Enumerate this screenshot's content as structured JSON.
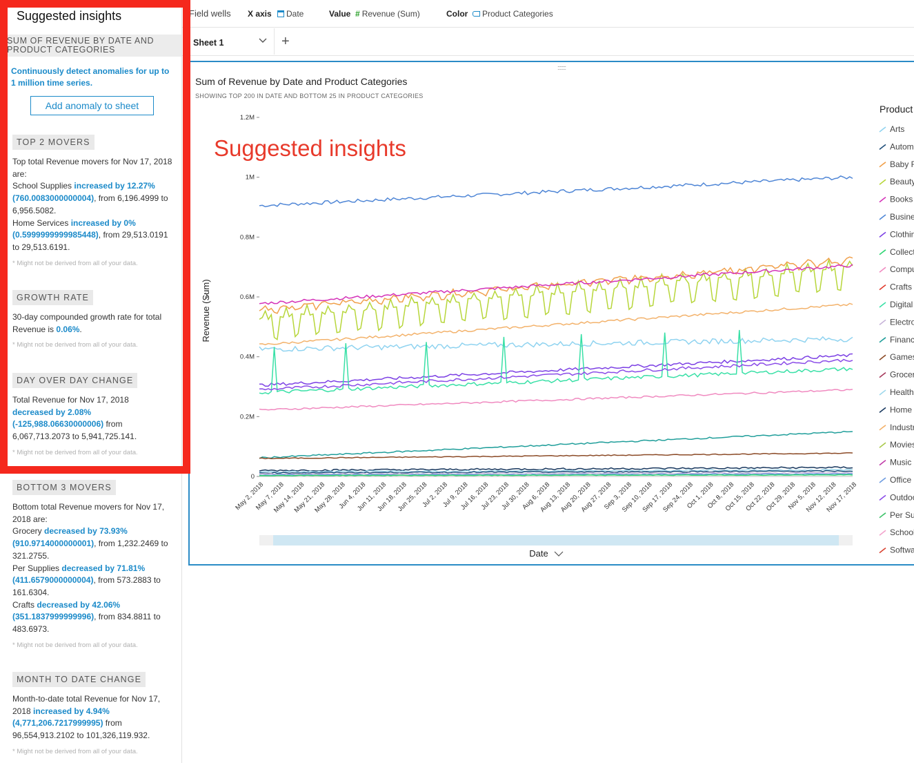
{
  "panel": {
    "title": "Suggested insights",
    "visual_header": "SUM OF REVENUE BY DATE AND PRODUCT CATEGORIES",
    "anomaly_text": "Continuously detect anomalies for up to 1 million time series.",
    "anomaly_button": "Add anomaly to sheet",
    "note": "* Might not be derived from all of your data.",
    "top_movers": {
      "tag": "TOP 2 MOVERS",
      "intro": "Top total Revenue movers for Nov 17, 2018 are:",
      "items": [
        {
          "name": "School Supplies",
          "change": "increased by 12.27% (760.0083000000004)",
          "detail": ", from 6,196.4999 to 6,956.5082."
        },
        {
          "name": "Home Services",
          "change": "increased by 0% (0.5999999999985448)",
          "detail": ", from 29,513.0191 to 29,513.6191."
        }
      ]
    },
    "growth": {
      "tag": "GROWTH RATE",
      "text": "30-day compounded growth rate for total Revenue is",
      "value": "0.06%",
      "suffix": "."
    },
    "day_over_day": {
      "tag": "DAY OVER DAY CHANGE",
      "text": "Total Revenue for Nov 17, 2018",
      "change": "decreased by 2.08% (-125,988.06630000006)",
      "detail": "from 6,067,713.2073 to 5,941,725.141."
    },
    "bottom_movers": {
      "tag": "BOTTOM 3 MOVERS",
      "intro": "Bottom total Revenue movers for Nov 17, 2018 are:",
      "items": [
        {
          "name": "Grocery",
          "change": "decreased by 73.93% (910.9714000000001)",
          "detail": ", from 1,232.2469 to 321.2755."
        },
        {
          "name": "Per Supplies",
          "change": "decreased by 71.81% (411.6579000000004)",
          "detail": ", from 573.2883 to 161.6304."
        },
        {
          "name": "Crafts",
          "change": "decreased by 42.06% (351.1837999999996)",
          "detail": ", from 834.8811 to 483.6973."
        }
      ]
    },
    "month_to_date": {
      "tag": "MONTH TO DATE CHANGE",
      "text": "Month-to-date total Revenue for Nov 17, 2018",
      "change": "increased by 4.94% (4,771,206.7217999995)",
      "detail": "from 96,554,913.2102 to 101,326,119.932."
    }
  },
  "field_wells": {
    "title": "Field wells",
    "x_label": "X axis",
    "x_value": "Date",
    "value_label": "Value",
    "value_value": "Revenue (Sum)",
    "color_label": "Color",
    "color_value": "Product Categories"
  },
  "tabs": {
    "sheet": "Sheet 1",
    "chevron": "∨",
    "add": "+"
  },
  "visual": {
    "title": "Sum of Revenue by Date and Product Categories",
    "subtitle": "SHOWING TOP 200 IN DATE AND BOTTOM 25 IN PRODUCT CATEGORIES",
    "overlay_label": "Suggested insights",
    "legend_title": "Product"
  },
  "chart_data": {
    "type": "line",
    "title": "Sum of Revenue by Date and Product Categories",
    "xlabel": "Date",
    "ylabel": "Revenue (Sum)",
    "y_ticks": [
      "0",
      "0.2M",
      "0.4M",
      "0.6M",
      "0.8M",
      "1M",
      "1.2M"
    ],
    "y_tick_values": [
      0,
      200000,
      400000,
      600000,
      800000,
      1000000,
      1200000
    ],
    "ylim": [
      0,
      1200000
    ],
    "x_ticks": [
      "May 2, 2018",
      "May 7, 2018",
      "May 14, 2018",
      "May 21, 2018",
      "May 28, 2018",
      "Jun 4, 2018",
      "Jun 11, 2018",
      "Jun 18, 2018",
      "Jun 25, 2018",
      "Jul 2, 2018",
      "Jul 9, 2018",
      "Jul 16, 2018",
      "Jul 23, 2018",
      "Jul 30, 2018",
      "Aug 6, 2018",
      "Aug 13, 2018",
      "Aug 20, 2018",
      "Aug 27, 2018",
      "Sep 3, 2018",
      "Sep 10, 2018",
      "Sep 17, 2018",
      "Sep 24, 2018",
      "Oct 1, 2018",
      "Oct 8, 2018",
      "Oct 15, 2018",
      "Oct 22, 2018",
      "Oct 29, 2018",
      "Nov 5, 2018",
      "Nov 12, 2018",
      "Nov 17, 2018"
    ],
    "legend": [
      {
        "name": "Arts",
        "color": "#8fd3f0"
      },
      {
        "name": "Autom",
        "color": "#1f4e79"
      },
      {
        "name": "Baby F",
        "color": "#f0a04b"
      },
      {
        "name": "Beauty",
        "color": "#b7d63a"
      },
      {
        "name": "Books",
        "color": "#d431b8"
      },
      {
        "name": "Busine",
        "color": "#4f86d6"
      },
      {
        "name": "Clothin",
        "color": "#7b3fe4"
      },
      {
        "name": "Collect",
        "color": "#2ed573"
      },
      {
        "name": "Compu",
        "color": "#f08ac0"
      },
      {
        "name": "Crafts",
        "color": "#e0392b"
      },
      {
        "name": "Digital",
        "color": "#38e0a6"
      },
      {
        "name": "Electro",
        "color": "#c7b3d9"
      },
      {
        "name": "Financ",
        "color": "#1f9e9a"
      },
      {
        "name": "Games",
        "color": "#8b4a26"
      },
      {
        "name": "Grocer",
        "color": "#a4375a"
      },
      {
        "name": "Health",
        "color": "#9ed8ec"
      },
      {
        "name": "Home",
        "color": "#17375e"
      },
      {
        "name": "Industr",
        "color": "#f3b26b"
      },
      {
        "name": "Movies",
        "color": "#a9c94a"
      },
      {
        "name": "Music",
        "color": "#c03aa8"
      },
      {
        "name": "Office",
        "color": "#6c9be0"
      },
      {
        "name": "Outdoo",
        "color": "#8a4be8"
      },
      {
        "name": "Per Su",
        "color": "#3fc36a"
      },
      {
        "name": "School",
        "color": "#f3a3cc"
      },
      {
        "name": "Softwa",
        "color": "#d9412f"
      }
    ],
    "series": [
      {
        "name": "Busine",
        "color": "#4f86d6",
        "start": 905000,
        "end": 1000000,
        "noise": 6000,
        "spike_dates": [],
        "seasonal": 0
      },
      {
        "name": "Beauty",
        "color": "#b7d63a",
        "start": 530000,
        "end": 700000,
        "noise": 8000,
        "spike_dates": [],
        "seasonal": 70000
      },
      {
        "name": "Baby F",
        "color": "#f0a04b",
        "start": 560000,
        "end": 725000,
        "noise": 8000,
        "spike_dates": [],
        "seasonal": 12000
      },
      {
        "name": "Books",
        "color": "#d431b8",
        "start": 578000,
        "end": 705000,
        "noise": 5000,
        "spike_dates": [],
        "seasonal": 0
      },
      {
        "name": "Industr",
        "color": "#f3b26b",
        "start": 440000,
        "end": 575000,
        "noise": 4000,
        "spike_dates": [],
        "seasonal": 0
      },
      {
        "name": "Arts",
        "color": "#8fd3f0",
        "start": 425000,
        "end": 460000,
        "noise": 9000,
        "spike_dates": [],
        "seasonal": 0
      },
      {
        "name": "Clothin",
        "color": "#7b3fe4",
        "start": 305000,
        "end": 405000,
        "noise": 5000,
        "spike_dates": [],
        "seasonal": 0
      },
      {
        "name": "Digital",
        "color": "#38e0a6",
        "start": 280000,
        "end": 360000,
        "noise": 6000,
        "spike_dates": [
          5,
          29,
          56,
          82,
          108,
          136,
          161
        ],
        "seasonal": 0
      },
      {
        "name": "Outdoo",
        "color": "#8a4be8",
        "start": 290000,
        "end": 390000,
        "noise": 5000,
        "spike_dates": [],
        "seasonal": 0
      },
      {
        "name": "Compu",
        "color": "#f08ac0",
        "start": 222000,
        "end": 290000,
        "noise": 3000,
        "spike_dates": [],
        "seasonal": 0
      },
      {
        "name": "Financ",
        "color": "#1f9e9a",
        "start": 62000,
        "end": 150000,
        "noise": 2500,
        "spike_dates": [],
        "seasonal": 0
      },
      {
        "name": "Games",
        "color": "#8b4a26",
        "start": 60000,
        "end": 78000,
        "noise": 1500,
        "spike_dates": [],
        "seasonal": 0
      },
      {
        "name": "Home",
        "color": "#17375e",
        "start": 20000,
        "end": 30000,
        "noise": 3000,
        "spike_dates": [],
        "seasonal": 0
      },
      {
        "name": "Health",
        "color": "#9ed8ec",
        "start": 15000,
        "end": 22000,
        "noise": 2500,
        "spike_dates": [],
        "seasonal": 0
      },
      {
        "name": "Autom",
        "color": "#1f4e79",
        "start": 12000,
        "end": 18000,
        "noise": 2000,
        "spike_dates": [],
        "seasonal": 0
      },
      {
        "name": "Electro",
        "color": "#c7b3d9",
        "start": 8000,
        "end": 12000,
        "noise": 2000,
        "spike_dates": [],
        "seasonal": 0
      },
      {
        "name": "Office",
        "color": "#6c9be0",
        "start": 5000,
        "end": 8000,
        "noise": 1500,
        "spike_dates": [],
        "seasonal": 0
      },
      {
        "name": "Collect",
        "color": "#2ed573",
        "start": 3000,
        "end": 5000,
        "noise": 1000,
        "spike_dates": [],
        "seasonal": 0
      }
    ]
  }
}
